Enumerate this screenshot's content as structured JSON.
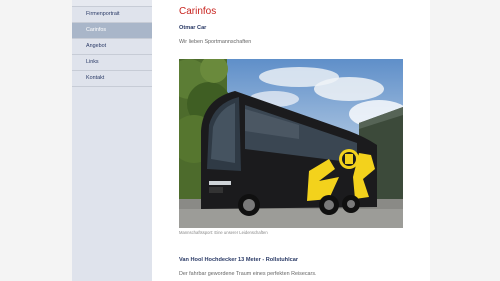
{
  "nav": {
    "items": [
      {
        "label": "Firmenportrait",
        "active": false
      },
      {
        "label": "Carinfos",
        "active": true
      },
      {
        "label": "Angebot",
        "active": false
      },
      {
        "label": "Links",
        "active": false
      },
      {
        "label": "Kontakt",
        "active": false
      }
    ]
  },
  "main": {
    "title": "Carinfos",
    "subheading": "Otmar Car",
    "lead": "Wir lieben Sportmannschaften",
    "photo_caption": "Mannschaftssport: Eine unserer Leidenschaften",
    "section": {
      "title": "Van Hool Hochdecker 13 Meter - Rollstuhlcar",
      "text": "Der fahrbar gewordene Traum eines perfekten Reisecars."
    }
  },
  "colors": {
    "accent_red": "#c8231e",
    "nav_text": "#2a3a66",
    "nav_active_bg": "#a9b6c9",
    "sidebar_bg": "#dfe3ec",
    "bus_yellow": "#f3d21c"
  }
}
